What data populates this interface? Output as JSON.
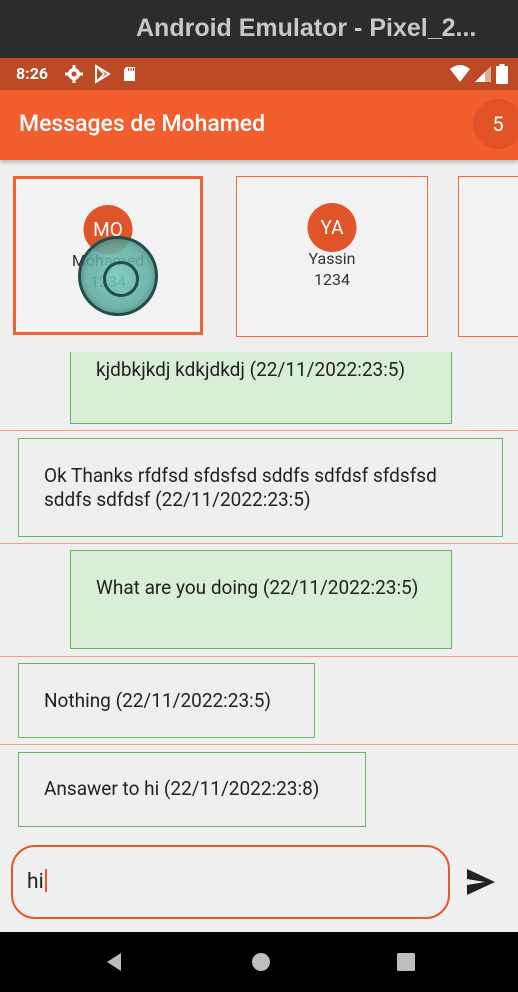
{
  "window": {
    "title": "Android Emulator - Pixel_2..."
  },
  "status_bar": {
    "time": "8:26",
    "left_icons": [
      "settings-icon",
      "play-store-icon",
      "sd-card-icon"
    ],
    "right_icons": [
      "wifi-icon",
      "signal-icon",
      "battery-icon"
    ]
  },
  "app_bar": {
    "title": "Messages de Mohamed",
    "badge": "5"
  },
  "contacts": [
    {
      "initials": "MO",
      "name": "Mohamed",
      "number": "1234",
      "selected": true
    },
    {
      "initials": "YA",
      "name": "Yassin",
      "number": "1234",
      "selected": false
    },
    {
      "initials": "",
      "name": "",
      "number": "",
      "selected": false
    }
  ],
  "messages": [
    {
      "text": "kjdbkjkdj kdkjdkdj (22/11/2022:23:5)",
      "mine": true
    },
    {
      "text": "Ok Thanks rfdfsd sfdsfsd sddfs sdfdsf sfdsfsd sddfs sdfdsf (22/11/2022:23:5)",
      "mine": false
    },
    {
      "text": "What are you doing (22/11/2022:23:5)",
      "mine": true
    },
    {
      "text": "Nothing (22/11/2022:23:5)",
      "mine": false
    },
    {
      "text": "Ansawer to hi (22/11/2022:23:8)",
      "mine": false
    }
  ],
  "composer": {
    "value": "hi"
  },
  "colors": {
    "status_bar": "#bc4a24",
    "app_bar": "#f25e2d",
    "accent": "#e0542a",
    "mine_bubble": "#d9eed7",
    "bubble_border": "#66b36a"
  }
}
